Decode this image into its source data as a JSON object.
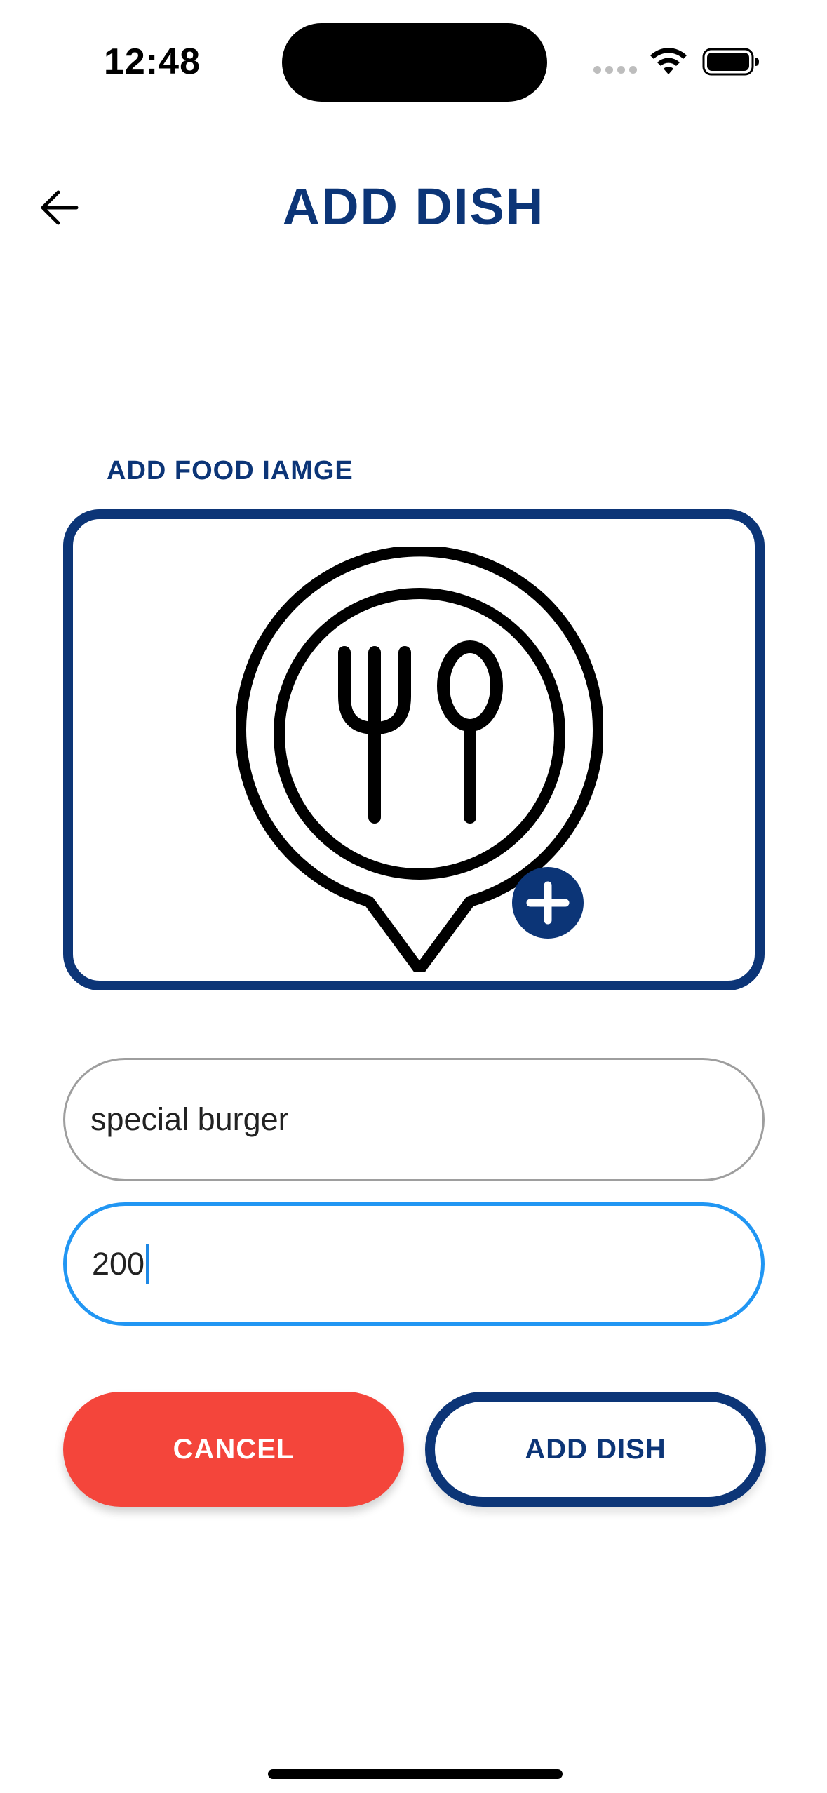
{
  "status_bar": {
    "time": "12:48",
    "icons": [
      "cellular-signal-icon",
      "wifi-icon",
      "battery-icon"
    ]
  },
  "header": {
    "back_icon": "arrow-left-icon",
    "title": "ADD DISH"
  },
  "image_picker": {
    "label": "ADD FOOD IAMGE",
    "icon": "restaurant-location-icon",
    "badge_icon": "plus-icon"
  },
  "form": {
    "name_value": "special burger",
    "price_value": "200"
  },
  "buttons": {
    "cancel_label": "CANCEL",
    "add_label": "ADD DISH"
  },
  "colors": {
    "primary": "#0c3577",
    "danger": "#f4453b",
    "focus": "#2196f3",
    "border_idle": "#9e9e9e"
  }
}
